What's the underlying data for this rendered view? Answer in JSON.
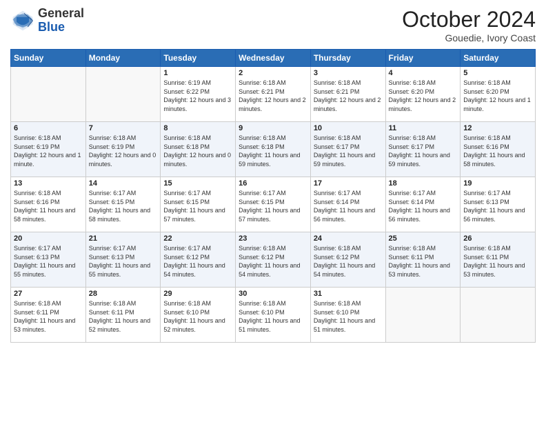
{
  "logo": {
    "line1": "General",
    "line2": "Blue"
  },
  "header": {
    "month": "October 2024",
    "location": "Gouedie, Ivory Coast"
  },
  "weekdays": [
    "Sunday",
    "Monday",
    "Tuesday",
    "Wednesday",
    "Thursday",
    "Friday",
    "Saturday"
  ],
  "weeks": [
    [
      {
        "day": "",
        "info": ""
      },
      {
        "day": "",
        "info": ""
      },
      {
        "day": "1",
        "info": "Sunrise: 6:19 AM\nSunset: 6:22 PM\nDaylight: 12 hours and 3 minutes."
      },
      {
        "day": "2",
        "info": "Sunrise: 6:18 AM\nSunset: 6:21 PM\nDaylight: 12 hours and 2 minutes."
      },
      {
        "day": "3",
        "info": "Sunrise: 6:18 AM\nSunset: 6:21 PM\nDaylight: 12 hours and 2 minutes."
      },
      {
        "day": "4",
        "info": "Sunrise: 6:18 AM\nSunset: 6:20 PM\nDaylight: 12 hours and 2 minutes."
      },
      {
        "day": "5",
        "info": "Sunrise: 6:18 AM\nSunset: 6:20 PM\nDaylight: 12 hours and 1 minute."
      }
    ],
    [
      {
        "day": "6",
        "info": "Sunrise: 6:18 AM\nSunset: 6:19 PM\nDaylight: 12 hours and 1 minute."
      },
      {
        "day": "7",
        "info": "Sunrise: 6:18 AM\nSunset: 6:19 PM\nDaylight: 12 hours and 0 minutes."
      },
      {
        "day": "8",
        "info": "Sunrise: 6:18 AM\nSunset: 6:18 PM\nDaylight: 12 hours and 0 minutes."
      },
      {
        "day": "9",
        "info": "Sunrise: 6:18 AM\nSunset: 6:18 PM\nDaylight: 11 hours and 59 minutes."
      },
      {
        "day": "10",
        "info": "Sunrise: 6:18 AM\nSunset: 6:17 PM\nDaylight: 11 hours and 59 minutes."
      },
      {
        "day": "11",
        "info": "Sunrise: 6:18 AM\nSunset: 6:17 PM\nDaylight: 11 hours and 59 minutes."
      },
      {
        "day": "12",
        "info": "Sunrise: 6:18 AM\nSunset: 6:16 PM\nDaylight: 11 hours and 58 minutes."
      }
    ],
    [
      {
        "day": "13",
        "info": "Sunrise: 6:18 AM\nSunset: 6:16 PM\nDaylight: 11 hours and 58 minutes."
      },
      {
        "day": "14",
        "info": "Sunrise: 6:17 AM\nSunset: 6:15 PM\nDaylight: 11 hours and 58 minutes."
      },
      {
        "day": "15",
        "info": "Sunrise: 6:17 AM\nSunset: 6:15 PM\nDaylight: 11 hours and 57 minutes."
      },
      {
        "day": "16",
        "info": "Sunrise: 6:17 AM\nSunset: 6:15 PM\nDaylight: 11 hours and 57 minutes."
      },
      {
        "day": "17",
        "info": "Sunrise: 6:17 AM\nSunset: 6:14 PM\nDaylight: 11 hours and 56 minutes."
      },
      {
        "day": "18",
        "info": "Sunrise: 6:17 AM\nSunset: 6:14 PM\nDaylight: 11 hours and 56 minutes."
      },
      {
        "day": "19",
        "info": "Sunrise: 6:17 AM\nSunset: 6:13 PM\nDaylight: 11 hours and 56 minutes."
      }
    ],
    [
      {
        "day": "20",
        "info": "Sunrise: 6:17 AM\nSunset: 6:13 PM\nDaylight: 11 hours and 55 minutes."
      },
      {
        "day": "21",
        "info": "Sunrise: 6:17 AM\nSunset: 6:13 PM\nDaylight: 11 hours and 55 minutes."
      },
      {
        "day": "22",
        "info": "Sunrise: 6:17 AM\nSunset: 6:12 PM\nDaylight: 11 hours and 54 minutes."
      },
      {
        "day": "23",
        "info": "Sunrise: 6:18 AM\nSunset: 6:12 PM\nDaylight: 11 hours and 54 minutes."
      },
      {
        "day": "24",
        "info": "Sunrise: 6:18 AM\nSunset: 6:12 PM\nDaylight: 11 hours and 54 minutes."
      },
      {
        "day": "25",
        "info": "Sunrise: 6:18 AM\nSunset: 6:11 PM\nDaylight: 11 hours and 53 minutes."
      },
      {
        "day": "26",
        "info": "Sunrise: 6:18 AM\nSunset: 6:11 PM\nDaylight: 11 hours and 53 minutes."
      }
    ],
    [
      {
        "day": "27",
        "info": "Sunrise: 6:18 AM\nSunset: 6:11 PM\nDaylight: 11 hours and 53 minutes."
      },
      {
        "day": "28",
        "info": "Sunrise: 6:18 AM\nSunset: 6:11 PM\nDaylight: 11 hours and 52 minutes."
      },
      {
        "day": "29",
        "info": "Sunrise: 6:18 AM\nSunset: 6:10 PM\nDaylight: 11 hours and 52 minutes."
      },
      {
        "day": "30",
        "info": "Sunrise: 6:18 AM\nSunset: 6:10 PM\nDaylight: 11 hours and 51 minutes."
      },
      {
        "day": "31",
        "info": "Sunrise: 6:18 AM\nSunset: 6:10 PM\nDaylight: 11 hours and 51 minutes."
      },
      {
        "day": "",
        "info": ""
      },
      {
        "day": "",
        "info": ""
      }
    ]
  ]
}
